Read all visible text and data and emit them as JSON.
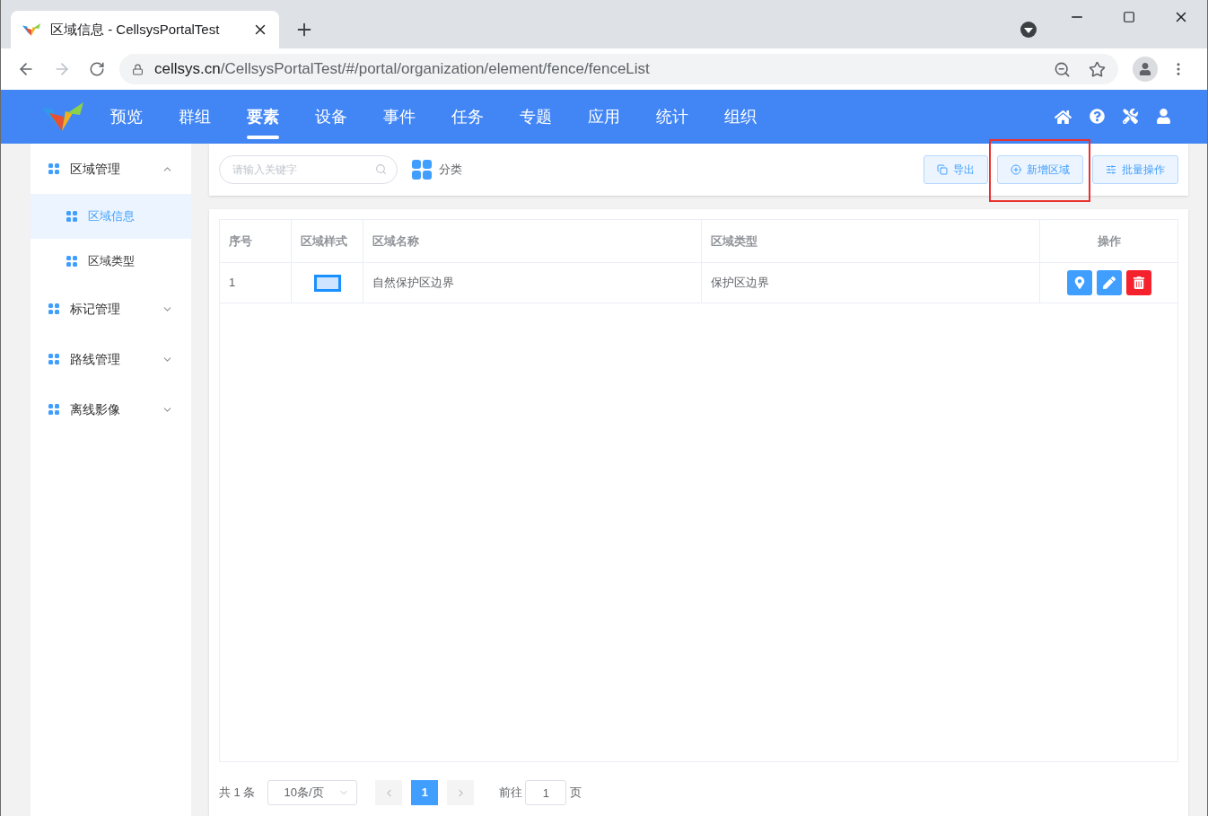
{
  "browser": {
    "tab_title": "区域信息 - CellsysPortalTest",
    "url_host": "cellsys.cn",
    "url_path": "/CellsysPortalTest/#/portal/organization/element/fence/fenceList"
  },
  "nav": {
    "items": [
      {
        "label": "预览",
        "selected": false
      },
      {
        "label": "群组",
        "selected": false
      },
      {
        "label": "要素",
        "selected": true
      },
      {
        "label": "设备",
        "selected": false
      },
      {
        "label": "事件",
        "selected": false
      },
      {
        "label": "任务",
        "selected": false
      },
      {
        "label": "专题",
        "selected": false
      },
      {
        "label": "应用",
        "selected": false
      },
      {
        "label": "统计",
        "selected": false
      },
      {
        "label": "组织",
        "selected": false
      }
    ]
  },
  "sidebar": {
    "items": [
      {
        "label": "区域管理",
        "expanded": true,
        "children": [
          {
            "label": "区域信息",
            "selected": true
          },
          {
            "label": "区域类型",
            "selected": false
          }
        ]
      },
      {
        "label": "标记管理",
        "expanded": false
      },
      {
        "label": "路线管理",
        "expanded": false
      },
      {
        "label": "离线影像",
        "expanded": false
      }
    ]
  },
  "toolbar": {
    "search": {
      "placeholder": "请输入关键字"
    },
    "category": "分类",
    "buttons": [
      {
        "kind": "export",
        "label": "导出"
      },
      {
        "kind": "add",
        "label": "新增区域",
        "highlighted": true
      },
      {
        "kind": "batch",
        "label": "批量操作"
      }
    ]
  },
  "table": {
    "columns": [
      "序号",
      "区域样式",
      "区域名称",
      "区域类型",
      "操作"
    ],
    "rows": [
      {
        "index": "1",
        "name": "自然保护区边界",
        "type": "保护区边界",
        "actions": [
          {
            "kind": "locate"
          },
          {
            "kind": "edit"
          },
          {
            "kind": "delete"
          }
        ]
      }
    ]
  },
  "pagination": {
    "total": "共 1 条",
    "page_size": "10条/页",
    "pages": [
      {
        "label": "1",
        "selected": true
      }
    ],
    "goto_label": "前往",
    "goto_value": "1",
    "goto_suffix": "页"
  }
}
